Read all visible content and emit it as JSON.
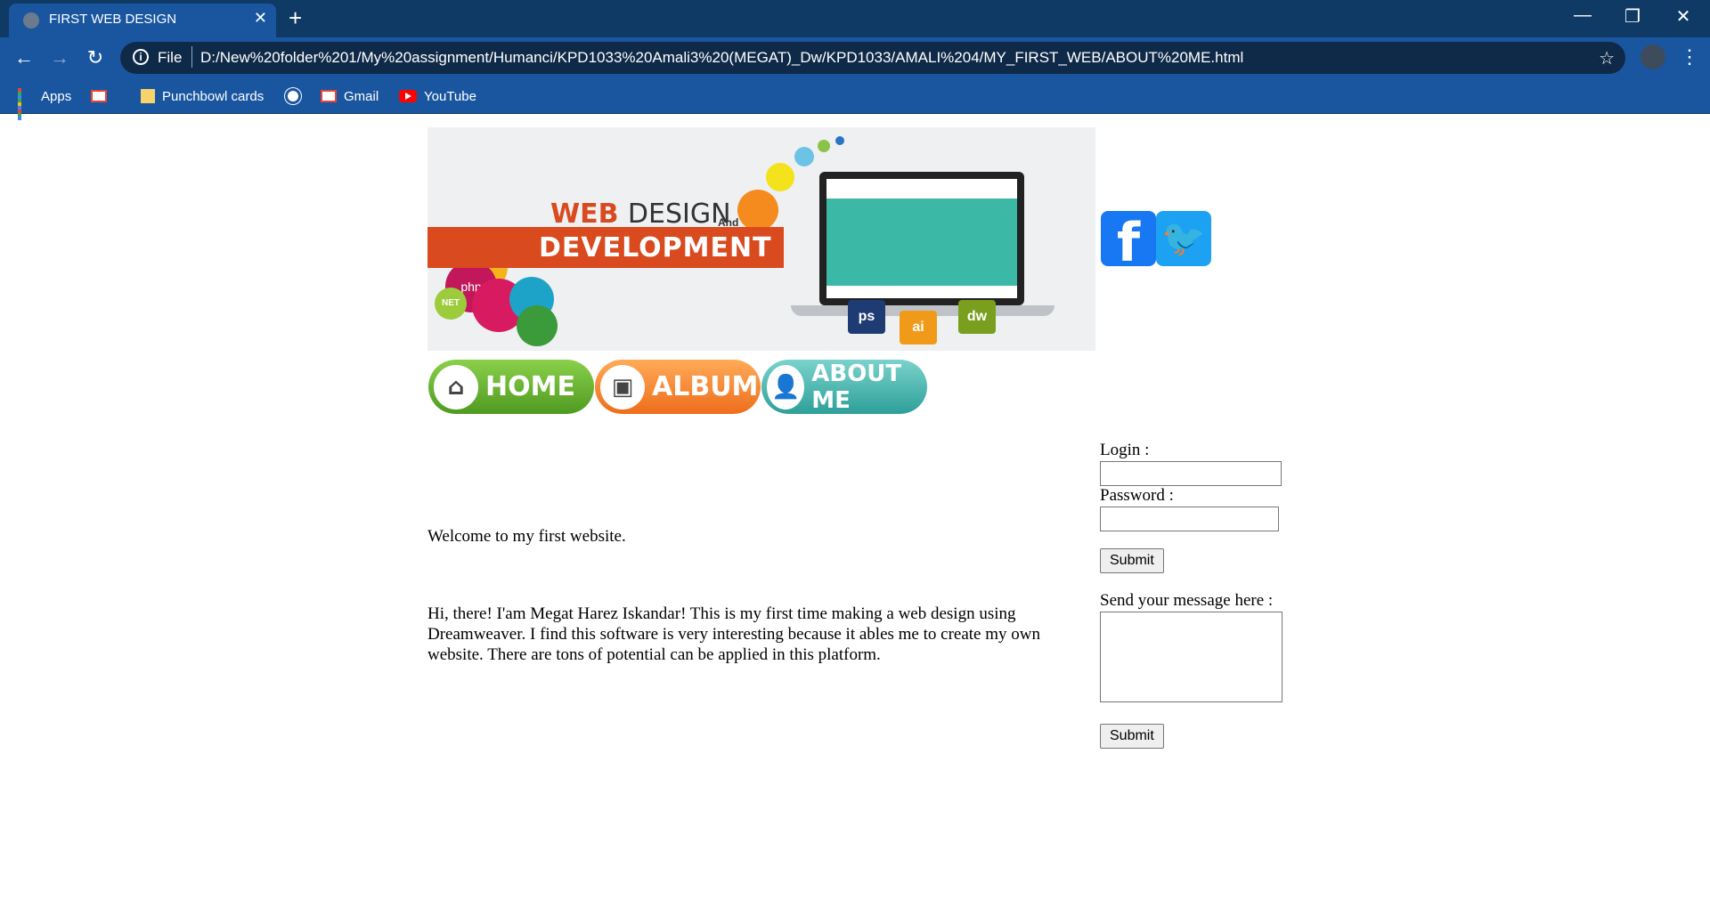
{
  "browser": {
    "tab_title": "FIRST WEB DESIGN",
    "tab_close": "✕",
    "new_tab": "+",
    "address_scheme": "File",
    "address_url": "D:/New%20folder%201/My%20assignment/Humanci/KPD1033%20Amali3%20(MEGAT)_Dw/KPD1033/AMALI%204/MY_FIRST_WEB/ABOUT%20ME.html",
    "window_buttons": [
      "—",
      "❐",
      "✕"
    ]
  },
  "bookmarks": [
    {
      "label": "Apps",
      "icon": "apps-grid-icon"
    },
    {
      "label": "",
      "icon": "gmail-icon"
    },
    {
      "label": "Punchbowl cards",
      "icon": "folder-icon"
    },
    {
      "label": "",
      "icon": "globe-icon"
    },
    {
      "label": "Gmail",
      "icon": "gmail-icon"
    },
    {
      "label": "YouTube",
      "icon": "youtube-icon"
    }
  ],
  "banner": {
    "web": "WEB",
    "design": "DESIGN",
    "and": "And",
    "development": "DEVELOPMENT",
    "badges": [
      "php",
      "NET",
      "ps",
      "ai",
      "dw"
    ]
  },
  "social": {
    "facebook": "f",
    "twitter": "🐦"
  },
  "nav": {
    "home": "HOME",
    "album": "ALBUM",
    "about": "ABOUT ME"
  },
  "main": {
    "welcome": "Welcome to my first website.",
    "intro": "Hi, there! I'am Megat Harez Iskandar! This is my first time making a web design using Dreamweaver. I find this software is very interesting because it ables me to create my own website. There are tons of potential can be applied in this platform."
  },
  "form": {
    "login_label": "Login :",
    "login_value": "",
    "password_label": "Password :",
    "password_value": "",
    "submit_label": "Submit",
    "message_label": "Send your message here :",
    "message_value": "",
    "submit2_label": "Submit"
  }
}
